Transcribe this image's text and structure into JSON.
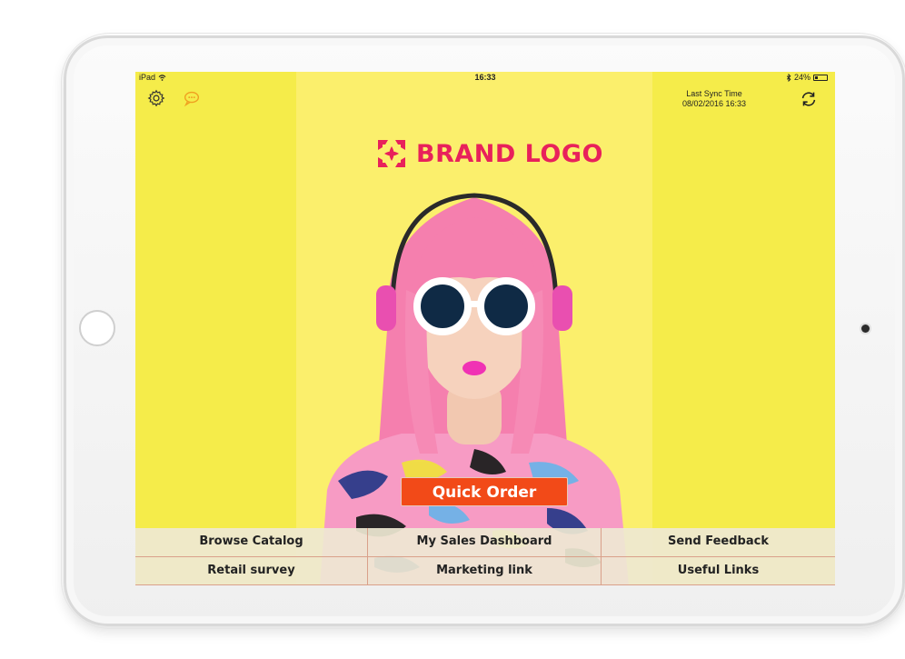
{
  "status_bar": {
    "device": "iPad",
    "time": "16:33",
    "battery": "24%"
  },
  "header": {
    "sync_label": "Last Sync Time",
    "sync_time": "08/02/2016 16:33"
  },
  "brand": {
    "logo_text": "BRAND LOGO",
    "color": "#e8215b"
  },
  "actions": {
    "quick_order": "Quick Order"
  },
  "menu": [
    {
      "label": "Browse Catalog"
    },
    {
      "label": "My Sales Dashboard"
    },
    {
      "label": "Send Feedback"
    },
    {
      "label": "Retail survey"
    },
    {
      "label": "Marketing link"
    },
    {
      "label": "Useful Links"
    }
  ],
  "icons": {
    "settings": "gear-icon",
    "chat": "chat-bubble-icon",
    "sync": "refresh-icon",
    "wifi": "wifi-icon",
    "bluetooth": "bluetooth-icon",
    "battery": "battery-icon"
  },
  "colors": {
    "background": "#f5ec4a",
    "accent": "#f24a18",
    "hair": "#f57fae"
  }
}
